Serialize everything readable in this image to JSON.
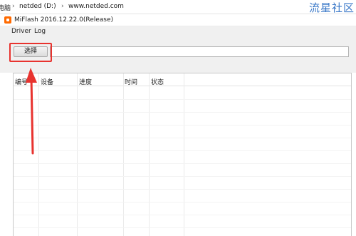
{
  "breadcrumb": {
    "items": [
      "电脑",
      "netded (D:)",
      "www.netded.com"
    ],
    "separator": "›"
  },
  "watermark": "流星社区",
  "window": {
    "title": "MiFlash 2016.12.22.0(Release)",
    "icon": "miflash-app-icon"
  },
  "menu": {
    "items": [
      "Driver",
      "Log"
    ]
  },
  "toolbar": {
    "select_label": "选择",
    "path_value": ""
  },
  "table": {
    "columns": [
      "编号",
      "设备",
      "进度",
      "时间",
      "状态"
    ],
    "rows": []
  },
  "colors": {
    "highlight": "#e8332f",
    "arrow": "#e8332f",
    "watermark": "#3a78c8"
  }
}
